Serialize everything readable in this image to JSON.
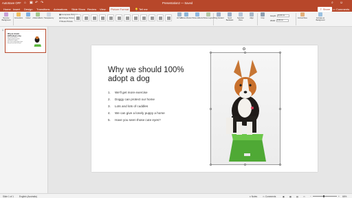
{
  "titlebar": {
    "autosave_label": "AutoSave",
    "autosave_state": "OFF",
    "title": "Presentation2 — Saved"
  },
  "tabs": [
    "Home",
    "Insert",
    "Design",
    "Transitions",
    "Animations",
    "Slide Show",
    "Review",
    "View",
    "Picture Format",
    "Tell me"
  ],
  "active_tab_index": 8,
  "share_label": "Share",
  "comments_label": "Comments",
  "ribbon": {
    "remove_background": "Remove Background",
    "corrections": "Corrections",
    "colour": "Colour",
    "artistic_effects": "Artistic Effects",
    "transparency": "Transparency",
    "compress_pictures": "Compress Pictures",
    "change_picture": "Change Picture",
    "reset_picture": "Reset Picture",
    "alt_text": "Alt Text",
    "picture_border": "Picture Border",
    "picture_effects": "Picture Effects",
    "picture_layout": "Picture Layout",
    "bring_forward": "Bring Forward",
    "send_backward": "Send Backward",
    "selection_pane": "Selection Pane",
    "align": "Align",
    "crop": "Crop",
    "height_label": "Height:",
    "height_value": "10.06 cm",
    "width_label": "Width:",
    "width_value": "6.36 cm",
    "format_pane": "Format Pane",
    "animate_as_background": "Animate as Background"
  },
  "slide": {
    "number": "1",
    "title": "Why we should 100% adopt a dog",
    "bullets": [
      "We'll get more exercise",
      "Doggy can protect our home",
      "Lots and lots of cuddles",
      "We can give a lonely puppy a home",
      "Have you seen those cute eyes?"
    ]
  },
  "status": {
    "slide": "Slide 1 of 1",
    "language": "English (Australia)",
    "notes": "Notes",
    "comments": "Comments",
    "zoom": "66%"
  },
  "colors": {
    "accent": "#b7472a",
    "stool": "#58b83a"
  }
}
